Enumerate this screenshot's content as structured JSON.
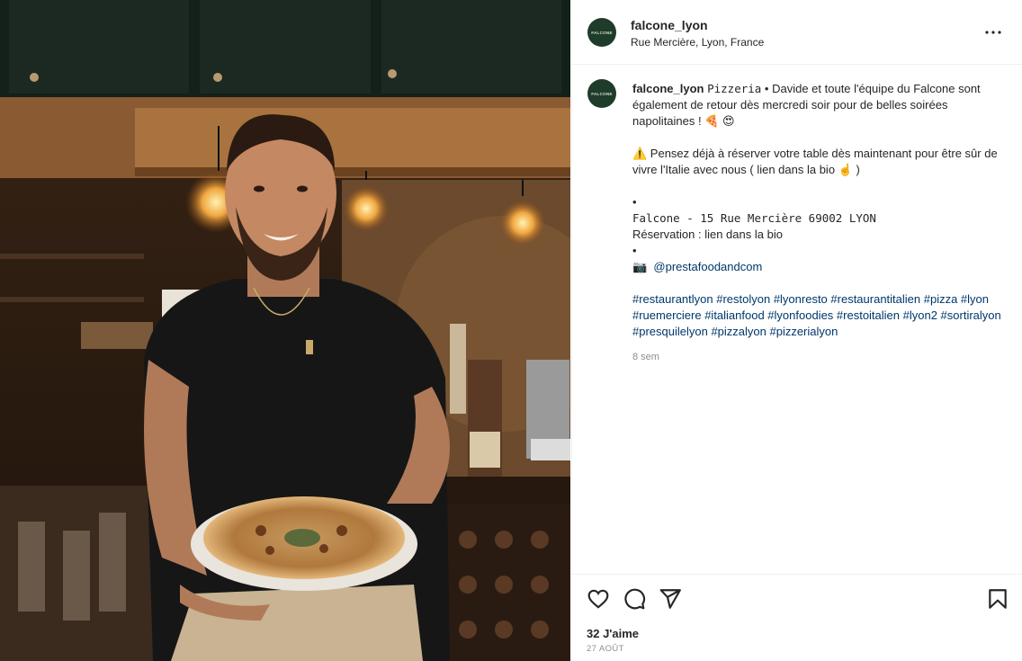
{
  "post": {
    "username": "falcone_lyon",
    "location": "Rue Mercière, Lyon, France",
    "avatar_text": "FALCONE"
  },
  "caption": {
    "username": "falcone_lyon",
    "line1_mono": "𝙿𝚒𝚣𝚣𝚎𝚛𝚒𝚊",
    "line1_text": " • Davide et toute l'équipe du Falcone sont également de retour dès mercredi soir pour de belles soirées napolitaines ! 🍕 😍",
    "line2": "⚠️  Pensez déjà à réserver votre table dès maintenant pour être sûr de vivre l'Italie avec nous ( lien dans la bio ☝️ )",
    "bullet": "•",
    "address": "Falcone - 15 Rue Mercière 69002 LYON",
    "reservation": "Réservation : lien dans la bio",
    "camera_icon": "📷",
    "photographer": "@prestafoodandcom",
    "hashtags": "#restaurantlyon #restolyon #lyonresto #restaurantitalien #pizza #lyon #ruemerciere #italianfood #lyonfoodies #restoitalien #lyon2 #sortiralyon #presquilelyon #pizzalyon #pizzerialyon",
    "time": "8 sem"
  },
  "footer": {
    "likes": "32 J'aime",
    "date": "27 AOÛT"
  },
  "icons": {
    "more": "more-options-icon",
    "like": "heart-icon",
    "comment": "comment-icon",
    "share": "share-icon",
    "save": "bookmark-icon"
  },
  "colors": {
    "avatar_bg": "#1f3b2a",
    "link": "#00376b",
    "muted": "#8e8e8e"
  }
}
